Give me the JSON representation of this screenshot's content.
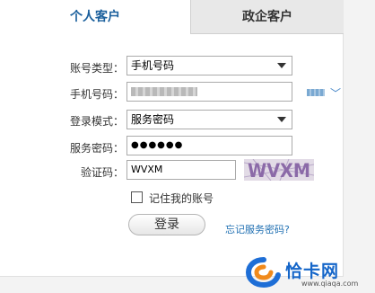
{
  "tabs": {
    "personal": "个人客户",
    "enterprise": "政企客户"
  },
  "form": {
    "account_type_label": "账号类型：",
    "account_type_value": "手机号码",
    "phone_label": "手机号码：",
    "login_mode_label": "登录模式：",
    "login_mode_value": "服务密码",
    "password_label": "服务密码：",
    "password_value": "●●●●●●",
    "captcha_label": "验证码：",
    "captcha_value": "WVXM",
    "captcha_image_text": "WVXM"
  },
  "remember_label": "记住我的账号",
  "login_button": "登录",
  "forgot_link": "忘记服务密码?",
  "watermark": {
    "brand": "恰卡网",
    "domain": "www.qiaqa.com"
  },
  "colors": {
    "tab_active": "#1a5f9c",
    "link": "#1f6fb2",
    "brand": "#1566c9"
  }
}
